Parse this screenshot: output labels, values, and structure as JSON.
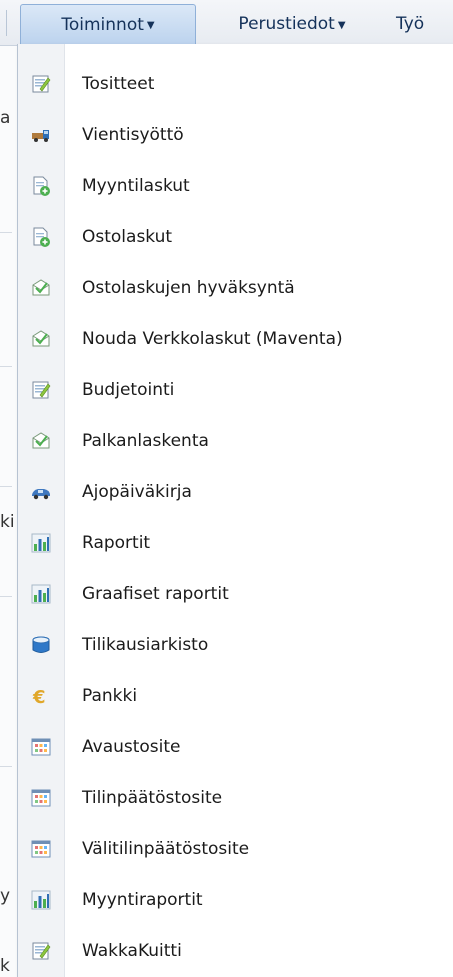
{
  "menubar": {
    "items": [
      {
        "label": "Toiminnot",
        "active": true
      },
      {
        "label": "Perustiedot",
        "active": false
      },
      {
        "label": "Työ",
        "active": false
      }
    ]
  },
  "background": {
    "chars": [
      "a",
      "ki",
      "y",
      "k"
    ]
  },
  "dropdown": {
    "items": [
      {
        "label": "Tositteet",
        "icon": "edit-document-icon"
      },
      {
        "label": "Vientisyöttö",
        "icon": "truck-icon"
      },
      {
        "label": "Myyntilaskut",
        "icon": "document-add-icon"
      },
      {
        "label": "Ostolaskut",
        "icon": "document-add-icon"
      },
      {
        "label": "Ostolaskujen hyväksyntä",
        "icon": "envelope-check-icon"
      },
      {
        "label": "Nouda Verkkolaskut (Maventa)",
        "icon": "envelope-check-icon"
      },
      {
        "label": "Budjetointi",
        "icon": "edit-document-icon"
      },
      {
        "label": "Palkanlaskenta",
        "icon": "envelope-check-icon"
      },
      {
        "label": "Ajopäiväkirja",
        "icon": "car-icon"
      },
      {
        "label": "Raportit",
        "icon": "bar-chart-icon"
      },
      {
        "label": "Graafiset raportit",
        "icon": "bar-chart-icon"
      },
      {
        "label": "Tilikausiarkisto",
        "icon": "archive-bin-icon"
      },
      {
        "label": "Pankki",
        "icon": "euro-icon"
      },
      {
        "label": "Avaustosite",
        "icon": "calendar-grid-icon"
      },
      {
        "label": "Tilinpäätöstosite",
        "icon": "calendar-grid-icon"
      },
      {
        "label": "Välitilinpäätöstosite",
        "icon": "calendar-grid-icon"
      },
      {
        "label": "Myyntiraportit",
        "icon": "bar-chart-icon"
      },
      {
        "label": "WakkaKuitti",
        "icon": "edit-document-icon"
      }
    ]
  }
}
